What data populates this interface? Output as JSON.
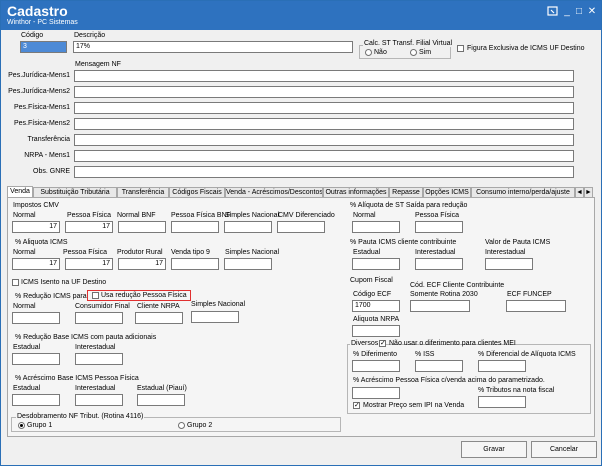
{
  "window": {
    "title": "Cadastro",
    "subtitle": "Winthor - PC Sistemas",
    "help_icon": "help-icon",
    "minimize_glyph": "_",
    "maximize_glyph": "□",
    "close_glyph": "✕"
  },
  "header": {
    "codigo_label": "Código",
    "codigo_value": "3",
    "descricao_label": "Descrição",
    "descricao_value": "17%",
    "calc_st_label": "Calc. ST Transf. Filial Virtual",
    "calc_st_nao": "Não",
    "calc_st_sim": "Sim",
    "figura_label": "Figura Exclusiva de ICMS UF Destino",
    "mensagem_label": "Mensagem NF"
  },
  "messages": [
    {
      "label": "Pes.Jurídica-Mens1",
      "value": ""
    },
    {
      "label": "Pes.Jurídica-Mens2",
      "value": ""
    },
    {
      "label": "Pes.Física-Mens1",
      "value": ""
    },
    {
      "label": "Pes.Física-Mens2",
      "value": ""
    },
    {
      "label": "Transferência",
      "value": ""
    },
    {
      "label": "NRPA - Mens1",
      "value": ""
    },
    {
      "label": "Obs. GNRE",
      "value": ""
    }
  ],
  "tabs": [
    "Venda",
    "Substituição Tributária",
    "Transferência",
    "Códigos Fiscais",
    "Venda - Acréscimos/Descontos",
    "Outras informações",
    "Repasse",
    "Opções ICMS",
    "Consumo interno/perda/ajuste"
  ],
  "tab_scroll": {
    "left": "◄",
    "right": "►"
  },
  "left": {
    "impostos_cmv": "Impostos CMV",
    "cmv_labels": [
      "Normal",
      "Pessoa Física",
      "Normal BNF",
      "Pessoa Física BNF",
      "Simples Nacional",
      "CMV Diferenciado"
    ],
    "cmv_values": [
      "17",
      "17",
      "",
      "",
      "",
      ""
    ],
    "aliquota_icms": "% Aliquota ICMS",
    "aliq_labels": [
      "Normal",
      "Pessoa Física",
      "Produtor Rural",
      "Venda tipo 9",
      "Simples Nacional"
    ],
    "aliq_values": [
      "17",
      "17",
      "17",
      "",
      ""
    ],
    "icms_isento": "ICMS Isento na UF Destino",
    "reducao_icms": "% Redução ICMS para",
    "usa_reducao": "Usa redução Pessoa Física",
    "red_labels": [
      "Normal",
      "Consumidor Final",
      "Cliente NRPA",
      "Simples Nacional"
    ],
    "red_values": [
      "",
      "",
      "",
      ""
    ],
    "reducao_base": "% Redução Base ICMS com pauta adicionais",
    "rb_labels": [
      "Estadual",
      "Interestadual"
    ],
    "rb_values": [
      "",
      ""
    ],
    "acrescimo_base": "% Acréscimo Base ICMS Pessoa Física",
    "ab_labels": [
      "Estadual",
      "Interestadual",
      "Estadual (Piauí)"
    ],
    "ab_values": [
      "",
      "",
      ""
    ],
    "desdobramento": "Desdobramento NF Tribut. (Rotina 4116)",
    "grupo1": "Grupo 1",
    "grupo2": "Grupo 2"
  },
  "right": {
    "aliq_st": "% Alíquota de ST Saída para redução",
    "st_labels": [
      "Normal",
      "Pessoa Física"
    ],
    "st_values": [
      "",
      ""
    ],
    "pauta_icms": "% Pauta ICMS cliente contribuinte",
    "pauta_labels": [
      "Estadual",
      "Interestadual"
    ],
    "pauta_values": [
      "",
      ""
    ],
    "valor_pauta": "Valor de Pauta ICMS",
    "valor_pauta_label": "Interestadual",
    "valor_pauta_value": "",
    "cupom_fiscal": "Cupom Fiscal",
    "codigo_ecf_label": "Código ECF",
    "codigo_ecf_value": "1700",
    "cod_ecf_contrib_label": "Cód. ECF Cliente Contribuinte",
    "somente_rotina": "Somente Rotina 2030",
    "ecf_funcep": "ECF FUNCEP",
    "aliquota_nrpa": "Aliquota NRPA",
    "diversos": "Diversos",
    "nao_diferimento": "Não usar o diferimento para clientes MEI",
    "div_labels": [
      "% Diferimento",
      "% ISS",
      "% Diferencial de Alíquota ICMS"
    ],
    "acrescimo_pf": "% Acréscimo Pessoa Física c/venda acima do parametrizado.",
    "tributos_nota": "% Tributos na nota fiscal",
    "mostrar_preco": "Mostrar Preço sem IPI na Venda"
  },
  "footer": {
    "gravar": "Gravar",
    "cancelar": "Cancelar"
  }
}
